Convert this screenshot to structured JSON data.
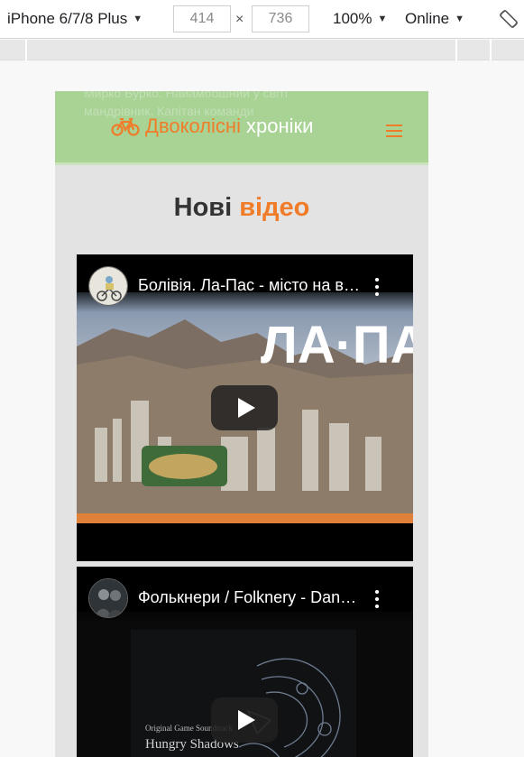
{
  "devtools": {
    "device": "iPhone 6/7/8 Plus",
    "width": "414",
    "times": "×",
    "height": "736",
    "zoom": "100%",
    "network": "Online"
  },
  "site": {
    "bg_text": "Мирко Бурко: Найамбошний у світі мандрівник. Капітан команди",
    "brand_word1": "Двоколісні",
    "brand_word2": "хроніки",
    "colors": {
      "accent": "#f07c2a",
      "navbar": "#a8d394"
    }
  },
  "section": {
    "title_part1": "Нові",
    "title_part2": "відео"
  },
  "videos": [
    {
      "title": "Болівія. Ла-Пас - місто на висоті",
      "thumb_text": "ЛА·ПАС"
    },
    {
      "title": "Фолькнери / Folknery - Dancing",
      "thumb_line1": "Original Game Soundtrack",
      "thumb_line2": "Hungry Shadows"
    }
  ]
}
